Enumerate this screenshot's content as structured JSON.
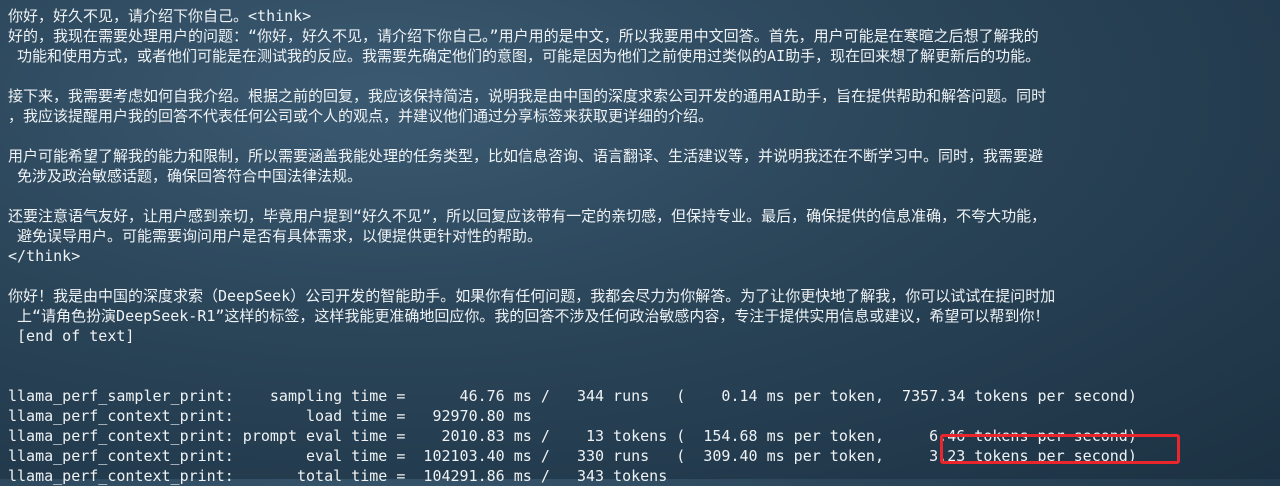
{
  "terminal": {
    "lines": [
      "你好，好久不见，请介绍下你自己。<think>",
      "好的，我现在需要处理用户的问题：“你好，好久不见，请介绍下你自己。”用户用的是中文，所以我要用中文回答。首先，用户可能是在寒暄之后想了解我的",
      " 功能和使用方式，或者他们可能是在测试我的反应。我需要先确定他们的意图，可能是因为他们之前使用过类似的AI助手，现在回来想了解更新后的功能。",
      "",
      "接下来，我需要考虑如何自我介绍。根据之前的回复，我应该保持简洁，说明我是由中国的深度求索公司开发的通用AI助手，旨在提供帮助和解答问题。同时",
      "，我应该提醒用户我的回答不代表任何公司或个人的观点，并建议他们通过分享标签来获取更详细的介绍。",
      "",
      "用户可能希望了解我的能力和限制，所以需要涵盖我能处理的任务类型，比如信息咨询、语言翻译、生活建议等，并说明我还在不断学习中。同时，我需要避",
      " 免涉及政治敏感话题，确保回答符合中国法律法规。",
      "",
      "还要注意语气友好，让用户感到亲切，毕竟用户提到“好久不见”，所以回复应该带有一定的亲切感，但保持专业。最后，确保提供的信息准确，不夸大功能，",
      " 避免误导用户。可能需要询问用户是否有具体需求，以便提供更针对性的帮助。",
      "</think>",
      "",
      "你好！我是由中国的深度求索（DeepSeek）公司开发的智能助手。如果你有任何问题，我都会尽力为你解答。为了让你更快地了解我，你可以试试在提问时加",
      " 上“请角色扮演DeepSeek-R1”这样的标签，这样我能更准确地回应你。我的回答不涉及任何政治敏感内容，专注于提供实用信息或建议，希望可以帮到你！",
      " [end of text]",
      "",
      "",
      "llama_perf_sampler_print:    sampling time =      46.76 ms /   344 runs   (    0.14 ms per token,  7357.34 tokens per second)",
      "llama_perf_context_print:        load time =   92970.80 ms",
      "llama_perf_context_print: prompt eval time =    2010.83 ms /    13 tokens (  154.68 ms per token,     6.46 tokens per second)",
      "llama_perf_context_print:        eval time =  102103.40 ms /   330 runs   (  309.40 ms per token,     3.23 tokens per second)",
      "llama_perf_context_print:       total time =  104291.86 ms /   343 tokens"
    ]
  },
  "highlight": {
    "color": "#e8262b",
    "text": "3.23 tokens per second)"
  }
}
